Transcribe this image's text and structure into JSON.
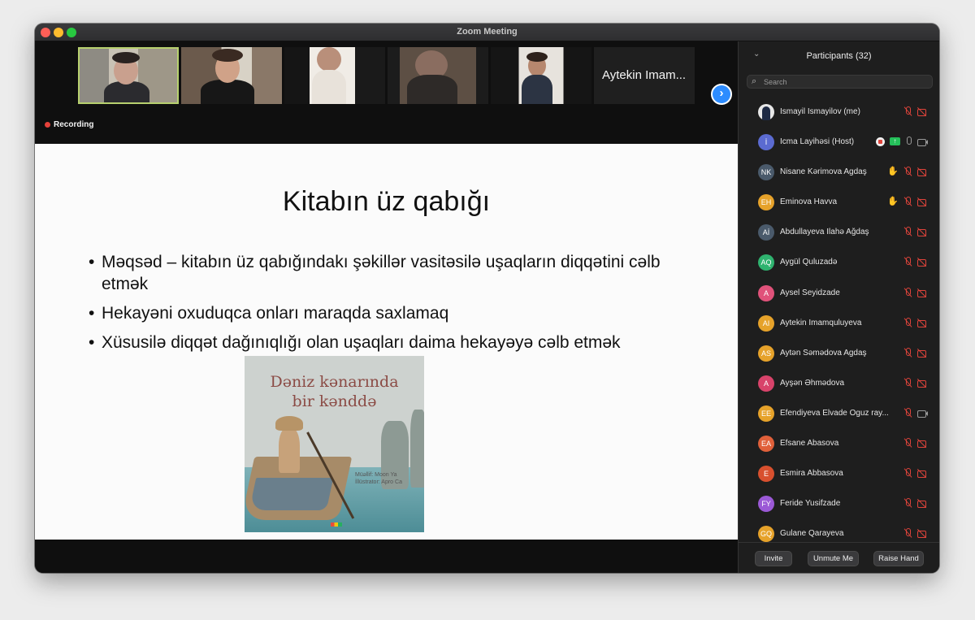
{
  "window": {
    "title": "Zoom Meeting"
  },
  "video_strip": {
    "tiles": [
      {
        "kind": "video"
      },
      {
        "kind": "video"
      },
      {
        "kind": "video"
      },
      {
        "kind": "video"
      },
      {
        "kind": "video"
      },
      {
        "kind": "name",
        "label": "Aytekin Imam..."
      }
    ],
    "next_icon": "chevron-right-icon"
  },
  "recording": {
    "label": "Recording",
    "dot_color": "#e5413a"
  },
  "slide": {
    "title": "Kitabın üz qabığı",
    "bullet_char": "•",
    "bullets": [
      "Məqsəd – kitabın üz qabığındakı şəkillər vasitəsilə uşaqların diqqətini cəlb etmək",
      "Hekayəni oxuduqca onları maraqda saxlamaq",
      "Xüsusilə diqqət dağınıqlığı olan uşaqları daima hekayəyə cəlb etmək"
    ],
    "book_cover": {
      "title_line1": "Dəniz kənarında",
      "title_line2": "bir kənddə",
      "credit_line1": "Müəllif: Moon Ya",
      "credit_line2": "İllüstrator: Apro Ca"
    }
  },
  "participants": {
    "title": "Participants (32)",
    "search_placeholder": "Search",
    "list": [
      {
        "name": "Ismayil İsmayilov (me)",
        "initials": "",
        "color": "#3a3a3a",
        "icons": [
          "mic-muted",
          "cam-off"
        ]
      },
      {
        "name": "İcma Layihəsi (Host)",
        "initials": "İ",
        "color": "#5b6bd1",
        "icons": [
          "stop-share",
          "share-green",
          "mic-on",
          "cam-on"
        ]
      },
      {
        "name": "Nisane Kərimova Agdaş",
        "initials": "NK",
        "color": "#4a5a6b",
        "icons": [
          "hand",
          "mic-muted",
          "cam-off"
        ]
      },
      {
        "name": "Eminova Havva",
        "initials": "EH",
        "color": "#e6a22a",
        "icons": [
          "hand",
          "mic-muted",
          "cam-off"
        ]
      },
      {
        "name": "Abdullayeva İlahə Ağdaş",
        "initials": "Aİ",
        "color": "#4a5a6b",
        "icons": [
          "mic-muted",
          "cam-off"
        ]
      },
      {
        "name": "Aygül Quluzadə",
        "initials": "AQ",
        "color": "#2fb36f",
        "icons": [
          "mic-muted",
          "cam-off"
        ]
      },
      {
        "name": "Aysel Seyidzade",
        "initials": "A",
        "color": "#e0527a",
        "icons": [
          "mic-muted",
          "cam-off"
        ]
      },
      {
        "name": "Aytekin Imamquluyeva",
        "initials": "AI",
        "color": "#e6a22a",
        "icons": [
          "mic-muted",
          "cam-off"
        ]
      },
      {
        "name": "Aytən Səmədova Agdaş",
        "initials": "AS",
        "color": "#e6a22a",
        "icons": [
          "mic-muted",
          "cam-off"
        ]
      },
      {
        "name": "Ayşən Əhmədova",
        "initials": "A",
        "color": "#d8436a",
        "icons": [
          "mic-muted",
          "cam-off"
        ]
      },
      {
        "name": "Efendiyeva Elvade Oguz ray...",
        "initials": "EE",
        "color": "#e6a22a",
        "icons": [
          "mic-muted",
          "cam-on"
        ]
      },
      {
        "name": "Efsane Abasova",
        "initials": "EA",
        "color": "#e0603a",
        "icons": [
          "mic-muted",
          "cam-off"
        ]
      },
      {
        "name": "Esmira Abbasova",
        "initials": "E",
        "color": "#d8502e",
        "icons": [
          "mic-muted",
          "cam-off"
        ]
      },
      {
        "name": "Feride Yusifzade",
        "initials": "FY",
        "color": "#9b59d6",
        "icons": [
          "mic-muted",
          "cam-off"
        ]
      },
      {
        "name": "Gulane Qarayeva",
        "initials": "GQ",
        "color": "#e6a22a",
        "icons": [
          "mic-muted",
          "cam-off"
        ]
      }
    ]
  },
  "footer": {
    "invite": "Invite",
    "unmute": "Unmute Me",
    "raise_hand": "Raise Hand"
  }
}
